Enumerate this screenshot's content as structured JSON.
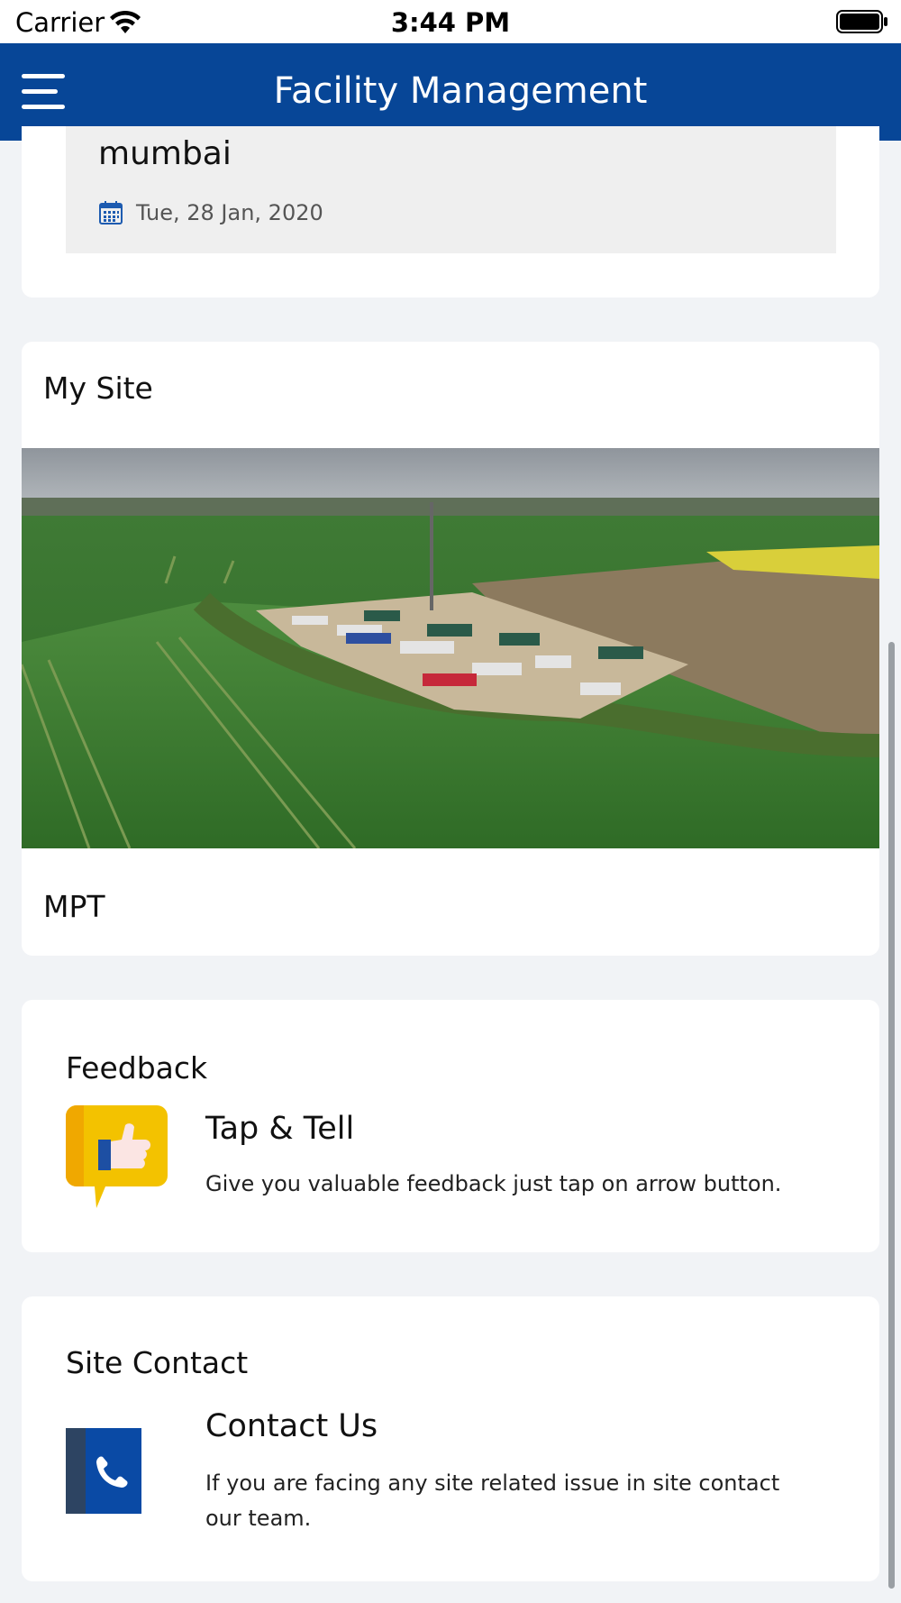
{
  "status_bar": {
    "carrier": "Carrier",
    "time": "3:44 PM",
    "icons": [
      "wifi-icon",
      "battery-icon"
    ]
  },
  "header": {
    "title": "Facility Management",
    "menu_icon": "hamburger-menu-icon",
    "background": "#074697"
  },
  "booking": {
    "location": "mumbai",
    "date": "Tue, 28 Jan, 2020",
    "icon": "calendar-icon"
  },
  "my_site": {
    "heading": "My Site",
    "site_name": "MPT"
  },
  "feedback": {
    "heading": "Feedback",
    "title": "Tap & Tell",
    "description": "Give you valuable feedback just tap on arrow button.",
    "icon": "thumbs-up-icon",
    "icon_color": "#f3c200"
  },
  "site_contact": {
    "heading": "Site Contact",
    "title": "Contact Us",
    "description": "If you are facing any site related issue in site contact our team.",
    "icon": "phone-icon",
    "icon_color": "#0a4aa5"
  }
}
